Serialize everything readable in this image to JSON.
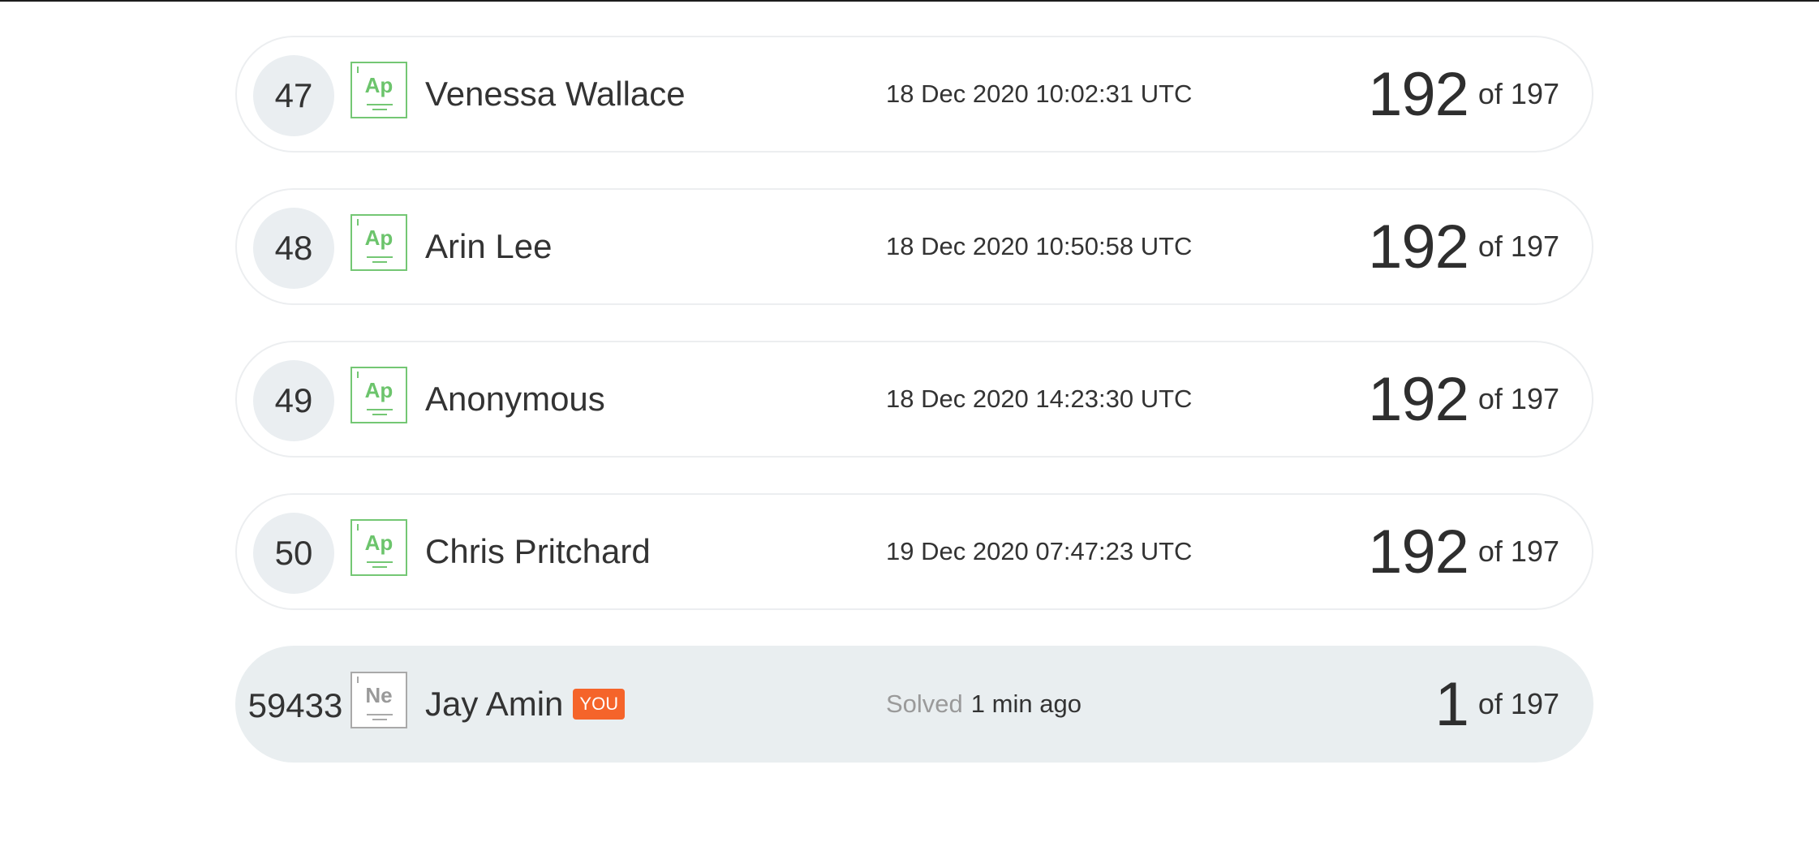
{
  "leaderboard": {
    "rows": [
      {
        "rank": "47",
        "element": "Ap",
        "name": "Venessa Wallace",
        "time": "18 Dec 2020 10:02:31 UTC",
        "score": "192",
        "total": "of 197"
      },
      {
        "rank": "48",
        "element": "Ap",
        "name": "Arin Lee",
        "time": "18 Dec 2020 10:50:58 UTC",
        "score": "192",
        "total": "of 197"
      },
      {
        "rank": "49",
        "element": "Ap",
        "name": "Anonymous",
        "time": "18 Dec 2020 14:23:30 UTC",
        "score": "192",
        "total": "of 197"
      },
      {
        "rank": "50",
        "element": "Ap",
        "name": "Chris Pritchard",
        "time": "19 Dec 2020 07:47:23 UTC",
        "score": "192",
        "total": "of 197"
      }
    ],
    "you": {
      "rank": "59433",
      "element": "Ne",
      "name": "Jay Amin",
      "badge": "YOU",
      "solved_label": "Solved",
      "solved_time": "1 min ago",
      "score": "1",
      "total": "of 197"
    }
  },
  "colors": {
    "accent_green": "#74c774",
    "badge_orange": "#f5642a",
    "you_row_bg": "#e9eef0"
  }
}
